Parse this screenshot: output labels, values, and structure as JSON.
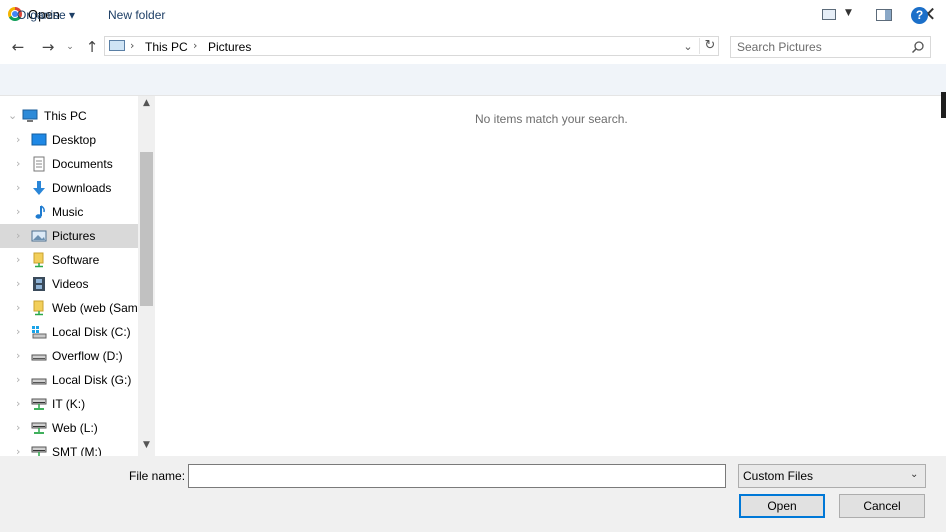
{
  "window": {
    "title": "Open",
    "close_glyph": "✕"
  },
  "nav": {
    "back_glyph": "←",
    "forward_glyph": "→",
    "recent_glyph": "⌄",
    "up_glyph": "↑"
  },
  "address": {
    "breadcrumbs": [
      "This PC",
      "Pictures"
    ],
    "separator": "›",
    "dropdown_glyph": "⌄",
    "refresh_glyph": "↻"
  },
  "search": {
    "placeholder": "Search Pictures",
    "value": ""
  },
  "commands": {
    "organise": "Organise ▾",
    "new_folder": "New folder",
    "view_dropdown_glyph": "▼",
    "help": "?"
  },
  "tree": {
    "items": [
      {
        "label": "This PC",
        "icon": "computer-icon",
        "level": 0,
        "expanded": true,
        "selected": false
      },
      {
        "label": "Desktop",
        "icon": "desktop-icon",
        "level": 1,
        "selected": false
      },
      {
        "label": "Documents",
        "icon": "documents-icon",
        "level": 1,
        "selected": false
      },
      {
        "label": "Downloads",
        "icon": "downloads-icon",
        "level": 1,
        "selected": false
      },
      {
        "label": "Music",
        "icon": "music-icon",
        "level": 1,
        "selected": false
      },
      {
        "label": "Pictures",
        "icon": "pictures-icon",
        "level": 1,
        "selected": true
      },
      {
        "label": "Software",
        "icon": "network-folder-icon",
        "level": 1,
        "selected": false
      },
      {
        "label": "Videos",
        "icon": "videos-icon",
        "level": 1,
        "selected": false
      },
      {
        "label": "Web (web (Samb",
        "icon": "network-folder-icon",
        "level": 1,
        "selected": false
      },
      {
        "label": "Local Disk (C:)",
        "icon": "windows-drive-icon",
        "level": 1,
        "selected": false
      },
      {
        "label": "Overflow (D:)",
        "icon": "drive-icon",
        "level": 1,
        "selected": false
      },
      {
        "label": "Local Disk (G:)",
        "icon": "drive-icon",
        "level": 1,
        "selected": false
      },
      {
        "label": "IT (K:)",
        "icon": "network-drive-icon",
        "level": 1,
        "selected": false
      },
      {
        "label": "Web (L:)",
        "icon": "network-drive-icon",
        "level": 1,
        "selected": false
      },
      {
        "label": "SMT (M:)",
        "icon": "network-drive-icon",
        "level": 1,
        "selected": false
      }
    ],
    "scroll_up_glyph": "▲",
    "scroll_down_glyph": "▼"
  },
  "content": {
    "empty_message": "No items match your search."
  },
  "footer": {
    "filename_label": "File name:",
    "filename_value": "",
    "filename_dropdown_glyph": "⌄",
    "filetype_selected": "Custom Files",
    "filetype_chevron": "⌄",
    "open_label": "Open",
    "cancel_label": "Cancel"
  },
  "colors": {
    "accent": "#0078d7",
    "selection": "#d9d9d9",
    "command_bar": "#f0f4f9",
    "link_text": "#1e3f66"
  }
}
